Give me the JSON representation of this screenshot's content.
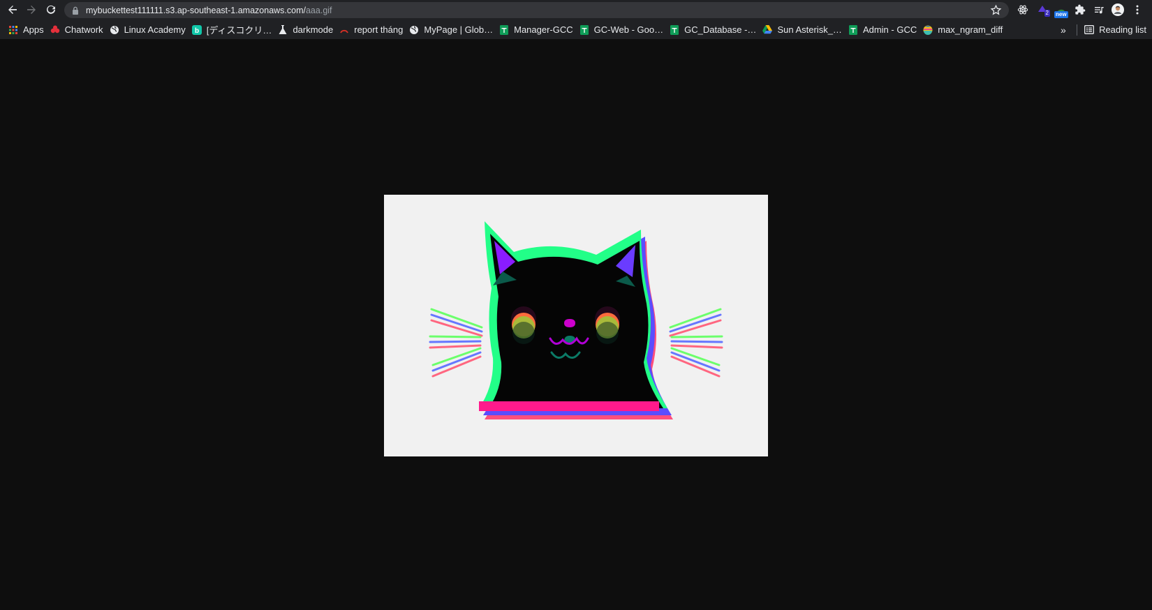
{
  "browser": {
    "url_host": "mybuckettest111111.s3.ap-southeast-1.amazonaws.com/",
    "url_path": "aaa.gif",
    "extension_badge_2": "2",
    "extension_badge_new": "new"
  },
  "bookmarks": {
    "items": [
      {
        "label": "Apps",
        "icon": "apps-grid-icon",
        "color": "#e94235"
      },
      {
        "label": "Chatwork",
        "icon": "chatwork-icon",
        "color": "#e5303b"
      },
      {
        "label": "Linux Academy",
        "icon": "globe-icon",
        "color": "#e8eaed"
      },
      {
        "label": "[ディスコクリ…",
        "icon": "b-logo-icon",
        "color": "#10c7a9"
      },
      {
        "label": "darkmode",
        "icon": "flask-icon",
        "color": "#e8eaed"
      },
      {
        "label": "report tháng",
        "icon": "red-arc-icon",
        "color": "#d93025"
      },
      {
        "label": "MyPage | Glob…",
        "icon": "globe-icon",
        "color": "#e8eaed"
      },
      {
        "label": "Manager-GCC",
        "icon": "sheets-icon",
        "color": "#0f9d58"
      },
      {
        "label": "GC-Web - Goo…",
        "icon": "sheets-icon",
        "color": "#0f9d58"
      },
      {
        "label": "GC_Database -…",
        "icon": "sheets-icon",
        "color": "#0f9d58"
      },
      {
        "label": "Sun Asterisk_…",
        "icon": "drive-icon",
        "color": "#fbbc04"
      },
      {
        "label": "Admin - GCC",
        "icon": "sheets-icon",
        "color": "#0f9d58"
      },
      {
        "label": "max_ngram_diff",
        "icon": "elastic-icon",
        "color": "#f3c316"
      }
    ],
    "overflow": "»",
    "reading_list": "Reading list"
  },
  "content": {
    "image_description": "glitch-effect-black-cat-gif",
    "background_color": "#0e0e0e",
    "image_background": "#f1f1f1"
  }
}
